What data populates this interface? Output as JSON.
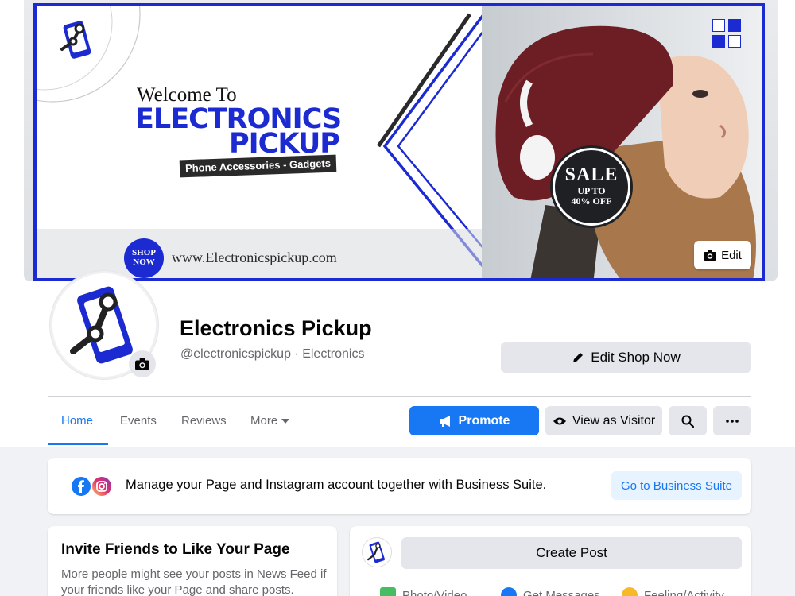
{
  "cover": {
    "welcome": "Welcome To",
    "brand_line1": "ELECTRONICS",
    "brand_line2": "PICKUP",
    "tagline": "Phone Accessories - Gadgets",
    "shop_now_line1": "SHOP",
    "shop_now_line2": "NOW",
    "url": "www.Electronicspickup.com",
    "sale_line1": "SALE",
    "sale_line2": "UP TO",
    "sale_line3": "40% OFF",
    "edit_label": "Edit",
    "accent_color": "#1b2ad1"
  },
  "profile": {
    "name": "Electronics Pickup",
    "handle": "@electronicspickup · Electronics",
    "edit_shop_label": "Edit Shop Now"
  },
  "tabs": [
    {
      "label": "Home",
      "active": true
    },
    {
      "label": "Events",
      "active": false
    },
    {
      "label": "Reviews",
      "active": false
    },
    {
      "label": "More",
      "active": false
    }
  ],
  "actions": {
    "promote_label": "Promote",
    "view_as_visitor_label": "View as Visitor"
  },
  "business_suite": {
    "text": "Manage your Page and Instagram account together with Business Suite.",
    "link_label": "Go to Business Suite"
  },
  "invite": {
    "title": "Invite Friends to Like Your Page",
    "text": "More people might see your posts in News Feed if your friends like your Page and share posts."
  },
  "create_post": {
    "button_label": "Create Post",
    "options": [
      "Photo/Video",
      "Get Messages",
      "Feeling/Activity"
    ]
  },
  "colors": {
    "facebook_blue": "#1877f2",
    "button_grey": "#e4e6eb",
    "background": "#f0f2f5"
  }
}
